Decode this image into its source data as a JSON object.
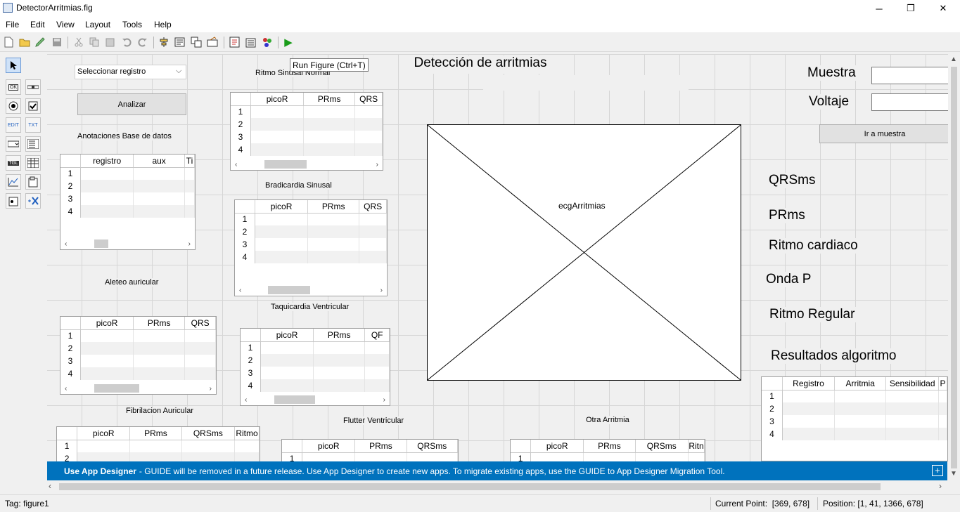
{
  "window": {
    "title": "DetectorArritmias.fig",
    "controls": [
      "─",
      "❐",
      "✕"
    ]
  },
  "menu": [
    "File",
    "Edit",
    "View",
    "Layout",
    "Tools",
    "Help"
  ],
  "tooltip": "Run Figure (Ctrl+T)",
  "registro_select": {
    "value": "Seleccionar registro"
  },
  "buttons": {
    "analizar": "Analizar",
    "ir_muestra": "Ir a muestra"
  },
  "labels": {
    "anotaciones": "Anotaciones Base de datos",
    "aleteo": "Aleteo auricular",
    "fibrilacion": "Fibrilacion Auricular",
    "ritmo_sinusal": "Ritmo Sinusal Normal",
    "bradicardia": "Bradicardia Sinusal",
    "taquicardia": "Taquicardia Ventricular",
    "flutter": "Flutter Ventricular",
    "otra": "Otra Arritmia",
    "main_title": "Detección de arritmias",
    "muestra": "Muestra",
    "voltaje": "Voltaje",
    "qrsms": "QRSms",
    "prms": "PRms",
    "ritmo_cardiaco": "Ritmo cardiaco",
    "onda_p": "Onda P",
    "ritmo_regular": "Ritmo Regular",
    "resultados": "Resultados algoritmo"
  },
  "axes": {
    "tag": "ecgArritmias"
  },
  "tables": {
    "anotaciones": {
      "columns": [
        "registro",
        "aux",
        "Ti"
      ],
      "rows": [
        "1",
        "2",
        "3",
        "4"
      ]
    },
    "aleteo": {
      "columns": [
        "picoR",
        "PRms",
        "QRS"
      ],
      "rows": [
        "1",
        "2",
        "3",
        "4"
      ]
    },
    "fibrilacion": {
      "columns": [
        "picoR",
        "PRms",
        "QRSms",
        "Ritmo"
      ],
      "rows": [
        "1",
        "2"
      ]
    },
    "ritmo_sinusal": {
      "columns": [
        "picoR",
        "PRms",
        "QRS"
      ],
      "rows": [
        "1",
        "2",
        "3",
        "4"
      ]
    },
    "bradicardia": {
      "columns": [
        "picoR",
        "PRms",
        "QRS"
      ],
      "rows": [
        "1",
        "2",
        "3",
        "4"
      ]
    },
    "taquicardia": {
      "columns": [
        "picoR",
        "PRms",
        "QF"
      ],
      "rows": [
        "1",
        "2",
        "3",
        "4"
      ]
    },
    "flutter": {
      "columns": [
        "picoR",
        "PRms",
        "QRSms"
      ],
      "rows": [
        "1"
      ]
    },
    "otra": {
      "columns": [
        "picoR",
        "PRms",
        "QRSms",
        "Ritn"
      ],
      "rows": [
        "1"
      ]
    },
    "resultados": {
      "columns": [
        "Registro",
        "Arritmia",
        "Sensibilidad",
        "P"
      ],
      "rows": [
        "1",
        "2",
        "3",
        "4"
      ]
    }
  },
  "banner": {
    "bold": "Use App Designer",
    "text": "- GUIDE will be removed in a future release. Use App Designer to create new apps. To migrate existing apps, use the GUIDE to App Designer Migration Tool."
  },
  "status": {
    "tag": "Tag: figure1",
    "current_point": "Current Point:  [369, 678]",
    "position": "Position: [1, 41, 1366, 678]"
  },
  "icons": {
    "run": "▶",
    "palette": [
      "select-arrow",
      "push-button",
      "slider",
      "radio-button",
      "checkbox",
      "edit-text",
      "static-text",
      "popup-menu",
      "listbox",
      "toggle-button",
      "table",
      "axes",
      "panel",
      "button-group",
      "activex"
    ]
  }
}
